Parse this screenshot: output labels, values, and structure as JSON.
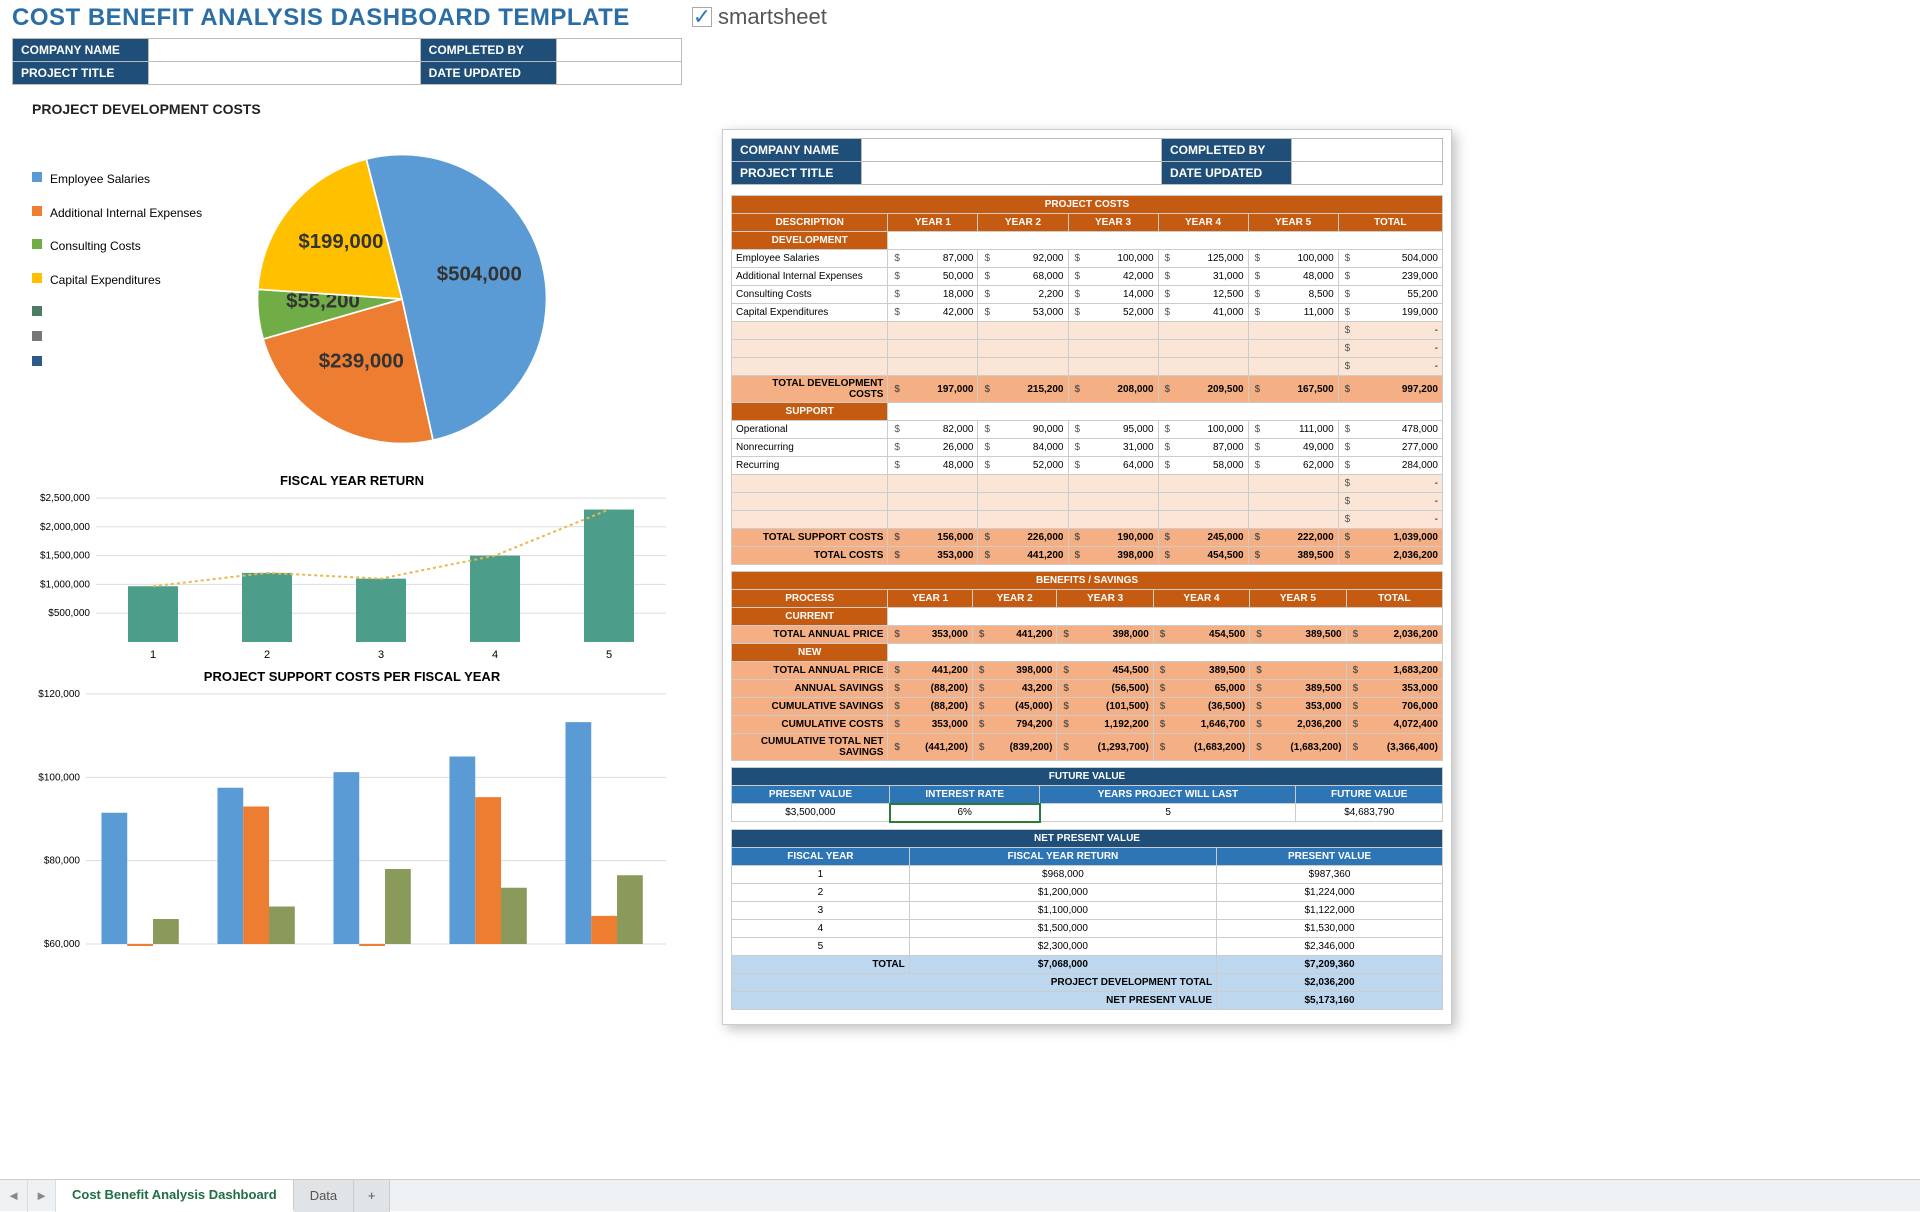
{
  "page_title": "COST BENEFIT ANALYSIS DASHBOARD TEMPLATE",
  "logo_text": "smartsheet",
  "header_fields": {
    "company_name_label": "COMPANY NAME",
    "project_title_label": "PROJECT TITLE",
    "completed_by_label": "COMPLETED BY",
    "date_updated_label": "DATE UPDATED"
  },
  "chart_titles": {
    "pie": "PROJECT DEVELOPMENT COSTS",
    "bar1": "FISCAL YEAR RETURN",
    "bar2": "PROJECT SUPPORT COSTS PER FISCAL YEAR"
  },
  "legend": [
    {
      "label": "Employee Salaries",
      "color": "#5b9bd5"
    },
    {
      "label": "Additional Internal Expenses",
      "color": "#ed7d31"
    },
    {
      "label": "Consulting Costs",
      "color": "#70ad47"
    },
    {
      "label": "Capital Expenditures",
      "color": "#ffc000"
    },
    {
      "label": "",
      "color": "#4c7c64"
    },
    {
      "label": "",
      "color": "#777"
    },
    {
      "label": "",
      "color": "#2e5a8a"
    }
  ],
  "table_headers": {
    "project_costs": "PROJECT COSTS",
    "description": "DESCRIPTION",
    "development": "DEVELOPMENT",
    "support": "SUPPORT",
    "years": [
      "YEAR 1",
      "YEAR 2",
      "YEAR 3",
      "YEAR 4",
      "YEAR 5"
    ],
    "total": "TOTAL",
    "total_dev": "TOTAL DEVELOPMENT COSTS",
    "total_support": "TOTAL SUPPORT COSTS",
    "total_costs": "TOTAL COSTS",
    "benefits": "BENEFITS / SAVINGS",
    "process": "PROCESS",
    "current": "CURRENT",
    "new": "NEW",
    "total_annual_price": "TOTAL ANNUAL PRICE",
    "annual_savings": "ANNUAL SAVINGS",
    "cum_savings": "CUMULATIVE SAVINGS",
    "cum_costs": "CUMULATIVE COSTS",
    "cum_net": "CUMULATIVE TOTAL NET SAVINGS",
    "future_value": "FUTURE VALUE",
    "present_value": "PRESENT VALUE",
    "interest_rate": "INTEREST RATE",
    "years_last": "YEARS PROJECT WILL LAST",
    "npv": "NET PRESENT VALUE",
    "fiscal_year": "FISCAL YEAR",
    "fiscal_year_return": "FISCAL YEAR RETURN",
    "proj_dev_total": "PROJECT DEVELOPMENT TOTAL"
  },
  "dev_rows": [
    {
      "label": "Employee Salaries",
      "v": [
        "87,000",
        "92,000",
        "100,000",
        "125,000",
        "100,000"
      ],
      "t": "504,000"
    },
    {
      "label": "Additional Internal Expenses",
      "v": [
        "50,000",
        "68,000",
        "42,000",
        "31,000",
        "48,000"
      ],
      "t": "239,000"
    },
    {
      "label": "Consulting Costs",
      "v": [
        "18,000",
        "2,200",
        "14,000",
        "12,500",
        "8,500"
      ],
      "t": "55,200"
    },
    {
      "label": "Capital Expenditures",
      "v": [
        "42,000",
        "53,000",
        "52,000",
        "41,000",
        "11,000"
      ],
      "t": "199,000"
    }
  ],
  "dev_total": {
    "v": [
      "197,000",
      "215,200",
      "208,000",
      "209,500",
      "167,500"
    ],
    "t": "997,200"
  },
  "sup_rows": [
    {
      "label": "Operational",
      "v": [
        "82,000",
        "90,000",
        "95,000",
        "100,000",
        "111,000"
      ],
      "t": "478,000"
    },
    {
      "label": "Nonrecurring",
      "v": [
        "26,000",
        "84,000",
        "31,000",
        "87,000",
        "49,000"
      ],
      "t": "277,000"
    },
    {
      "label": "Recurring",
      "v": [
        "48,000",
        "52,000",
        "64,000",
        "58,000",
        "62,000"
      ],
      "t": "284,000"
    }
  ],
  "sup_total": {
    "v": [
      "156,000",
      "226,000",
      "190,000",
      "245,000",
      "222,000"
    ],
    "t": "1,039,000"
  },
  "costs_total": {
    "v": [
      "353,000",
      "441,200",
      "398,000",
      "454,500",
      "389,500"
    ],
    "t": "2,036,200"
  },
  "benefits": {
    "current_total": {
      "v": [
        "353,000",
        "441,200",
        "398,000",
        "454,500",
        "389,500"
      ],
      "t": "2,036,200"
    },
    "new_total": {
      "v": [
        "441,200",
        "398,000",
        "454,500",
        "389,500",
        ""
      ],
      "t": "1,683,200"
    },
    "annual_savings": {
      "v": [
        "(88,200)",
        "43,200",
        "(56,500)",
        "65,000",
        "389,500"
      ],
      "t": "353,000"
    },
    "cum_savings": {
      "v": [
        "(88,200)",
        "(45,000)",
        "(101,500)",
        "(36,500)",
        "353,000"
      ],
      "t": "706,000"
    },
    "cum_costs": {
      "v": [
        "353,000",
        "794,200",
        "1,192,200",
        "1,646,700",
        "2,036,200"
      ],
      "t": "4,072,400"
    },
    "cum_net": {
      "v": [
        "(441,200)",
        "(839,200)",
        "(1,293,700)",
        "(1,683,200)",
        "(1,683,200)"
      ],
      "t": "(3,366,400)"
    }
  },
  "future": {
    "present_value": "$3,500,000",
    "interest_rate": "6%",
    "years": "5",
    "future_value": "$4,683,790"
  },
  "npv": {
    "rows": [
      {
        "y": "1",
        "r": "$968,000",
        "pv": "$987,360"
      },
      {
        "y": "2",
        "r": "$1,200,000",
        "pv": "$1,224,000"
      },
      {
        "y": "3",
        "r": "$1,100,000",
        "pv": "$1,122,000"
      },
      {
        "y": "4",
        "r": "$1,500,000",
        "pv": "$1,530,000"
      },
      {
        "y": "5",
        "r": "$2,300,000",
        "pv": "$2,346,000"
      }
    ],
    "total_r": "$7,068,000",
    "total_pv": "$7,209,360",
    "proj_dev_total": "$2,036,200",
    "net_pv": "$5,173,160"
  },
  "tabs": {
    "t1": "Cost Benefit Analysis Dashboard",
    "t2": "Data"
  },
  "chart_data": [
    {
      "type": "pie",
      "title": "PROJECT DEVELOPMENT COSTS",
      "series": [
        {
          "name": "Employee Salaries",
          "value": 504000,
          "label": "$504,000",
          "color": "#5b9bd5"
        },
        {
          "name": "Additional Internal Expenses",
          "value": 239000,
          "label": "$239,000",
          "color": "#ed7d31"
        },
        {
          "name": "Consulting Costs",
          "value": 55200,
          "label": "$55,200",
          "color": "#70ad47"
        },
        {
          "name": "Capital Expenditures",
          "value": 199000,
          "label": "$199,000",
          "color": "#ffc000"
        }
      ]
    },
    {
      "type": "bar",
      "title": "FISCAL YEAR RETURN",
      "categories": [
        "1",
        "2",
        "3",
        "4",
        "5"
      ],
      "values": [
        968000,
        1200000,
        1100000,
        1500000,
        2300000
      ],
      "ylim": [
        0,
        2500000
      ],
      "yticks": [
        "$2,500,000",
        "$2,000,000",
        "$1,500,000",
        "$1,000,000",
        "$500,000"
      ],
      "color": "#4c9d8a"
    },
    {
      "type": "bar_grouped",
      "title": "PROJECT SUPPORT COSTS PER FISCAL YEAR",
      "categories": [
        "1",
        "2",
        "3",
        "4",
        "5"
      ],
      "series": [
        {
          "name": "Operational",
          "color": "#5b9bd5",
          "values": [
            82000,
            90000,
            95000,
            100000,
            111000
          ]
        },
        {
          "name": "Nonrecurring",
          "color": "#ed7d31",
          "values": [
            26000,
            84000,
            31000,
            87000,
            49000
          ]
        },
        {
          "name": "Recurring",
          "color": "#8a9a5b",
          "values": [
            48000,
            52000,
            64000,
            58000,
            62000
          ]
        }
      ],
      "ylim": [
        40000,
        120000
      ],
      "yticks": [
        "$120,000",
        "$100,000",
        "$80,000",
        "$60,000"
      ]
    }
  ]
}
